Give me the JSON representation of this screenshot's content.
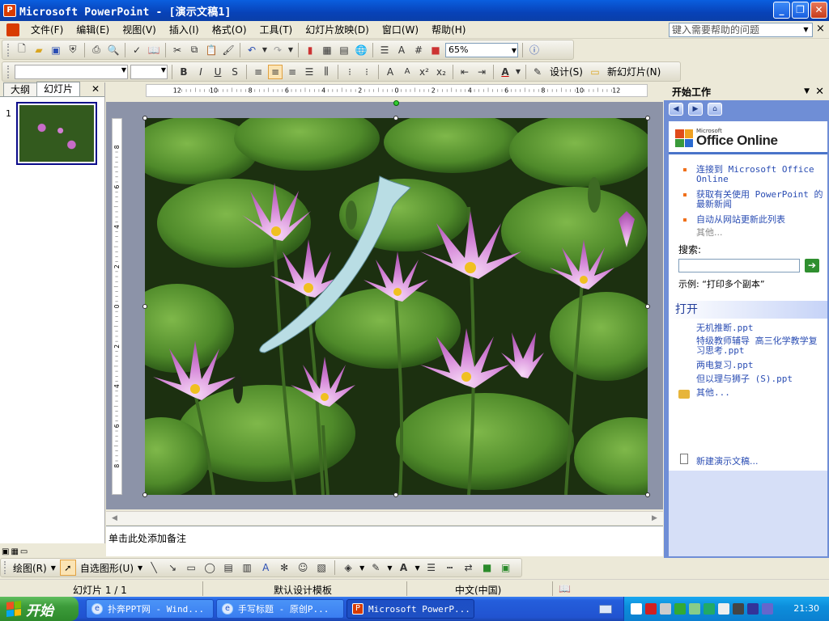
{
  "window": {
    "title": "Microsoft PowerPoint - [演示文稿1]",
    "app_icon": "powerpoint-icon",
    "controls": [
      "minimize",
      "restore",
      "close"
    ]
  },
  "menu": {
    "items": [
      "文件(F)",
      "编辑(E)",
      "视图(V)",
      "插入(I)",
      "格式(O)",
      "工具(T)",
      "幻灯片放映(D)",
      "窗口(W)",
      "帮助(H)"
    ],
    "help_placeholder": "键入需要帮助的问题",
    "close_label": "×"
  },
  "toolbar_standard": {
    "zoom": "65%"
  },
  "toolbar_formatting": {
    "design_label": "设计(S)",
    "new_slide_label": "新幻灯片(N)"
  },
  "left_pane": {
    "tabs": [
      "大纲",
      "幻灯片"
    ],
    "active_tab": "幻灯片",
    "slide_number": "1"
  },
  "ruler": {
    "h_labels": [
      "12",
      "10",
      "8",
      "6",
      "4",
      "2",
      "0",
      "2",
      "4",
      "6",
      "8",
      "10",
      "12"
    ],
    "v_labels": [
      "8",
      "6",
      "4",
      "2",
      "0",
      "2",
      "4",
      "6",
      "8"
    ]
  },
  "notes": {
    "placeholder": "单击此处添加备注"
  },
  "task_pane": {
    "title": "开始工作",
    "office_online": {
      "logo_text": "Office Online",
      "logo_small": "Microsoft",
      "links": [
        "连接到 Microsoft Office Online",
        "获取有关使用 PowerPoint 的最新新闻",
        "自动从网站更新此列表"
      ],
      "more": "其他..."
    },
    "search_label": "搜索:",
    "example": "示例:  “打印多个副本”",
    "open_header": "打开",
    "recent_files": [
      "无机推断.ppt",
      "特级教师辅导 高三化学教学复习思考.ppt",
      "两电复习.ppt",
      "但以理与狮子 (S).ppt"
    ],
    "open_more": "其他...",
    "new_doc": "新建演示文稿..."
  },
  "drawing_toolbar": {
    "draw_label": "绘图(R)",
    "autoshape_label": "自选图形(U)"
  },
  "status_bar": {
    "slide_info": "幻灯片 1 / 1",
    "template": "默认设计模板",
    "language": "中文(中国)"
  },
  "taskbar": {
    "start_label": "开始",
    "items": [
      "扑奔PPT网 - Wind...",
      "手写标题 - 原创P...",
      "Microsoft PowerP..."
    ],
    "clock": "21:30"
  },
  "colors": {
    "title_blue": "#0a5fdf",
    "taskpane_blue": "#6f8ed6",
    "link_blue": "#2a4db3",
    "slide_shape_fill": "#b9dde4"
  }
}
